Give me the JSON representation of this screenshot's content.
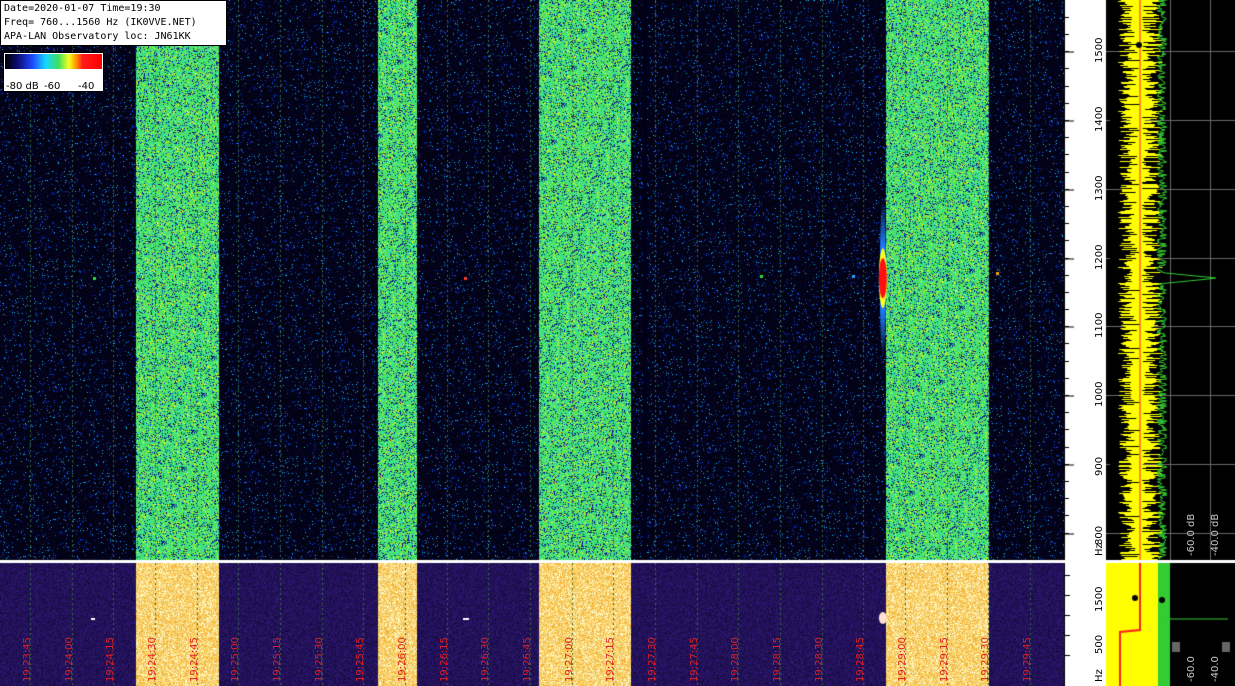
{
  "header": {
    "line1": "Date=2020-01-07 Time=19:30",
    "line2": "Freq= 760...1560 Hz (IK0VVE.NET)",
    "line3": "APA-LAN Observatory loc: JN61KK"
  },
  "legend": {
    "labels": [
      "-80 dB",
      "-60",
      "-40"
    ]
  },
  "colors": {
    "scale_bg": "#ffffff",
    "time_label": "#e02020",
    "spectrum_yellow": "#ffff00",
    "spectrum_green": "#33cc33",
    "avg_red": "#ff2020"
  },
  "chart_data": [
    {
      "type": "heatmap",
      "title": "",
      "x_ticks": [
        "19:23:45",
        "19:24:00",
        "19:24:15",
        "19:24:30",
        "19:24:45",
        "19:25:00",
        "19:25:15",
        "19:25:30",
        "19:25:45",
        "19:26:00",
        "19:26:15",
        "19:26:30",
        "19:26:45",
        "19:27:00",
        "19:27:15",
        "19:27:30",
        "19:27:45",
        "19:28:00",
        "19:28:15",
        "19:28:30",
        "19:28:45",
        "19:29:00",
        "19:29:15",
        "19:29:30",
        "19:29:45"
      ],
      "y_ticks": [
        "1500",
        "1400",
        "1300",
        "1200",
        "1100",
        "1000",
        "900",
        "800"
      ],
      "y_unit": "Hz",
      "ylim": [
        760,
        1560
      ],
      "signal_bands": [
        {
          "start": "19:24:23",
          "end": "19:24:53"
        },
        {
          "start": "19:25:50",
          "end": "19:26:04"
        },
        {
          "start": "19:26:48",
          "end": "19:27:21"
        },
        {
          "start": "19:28:53",
          "end": "19:29:30"
        }
      ],
      "strong_echo": {
        "time": "19:28:52",
        "freq_hz": 1170
      },
      "spectrum_db_labels": [
        "-60.0 dB",
        "-40.0 dB"
      ]
    },
    {
      "type": "heatmap",
      "title": "",
      "y_ticks": [
        "1500",
        "500"
      ],
      "y_unit": "Hz",
      "spectrum_db_labels": [
        "-60.0",
        "-40.0"
      ]
    }
  ]
}
